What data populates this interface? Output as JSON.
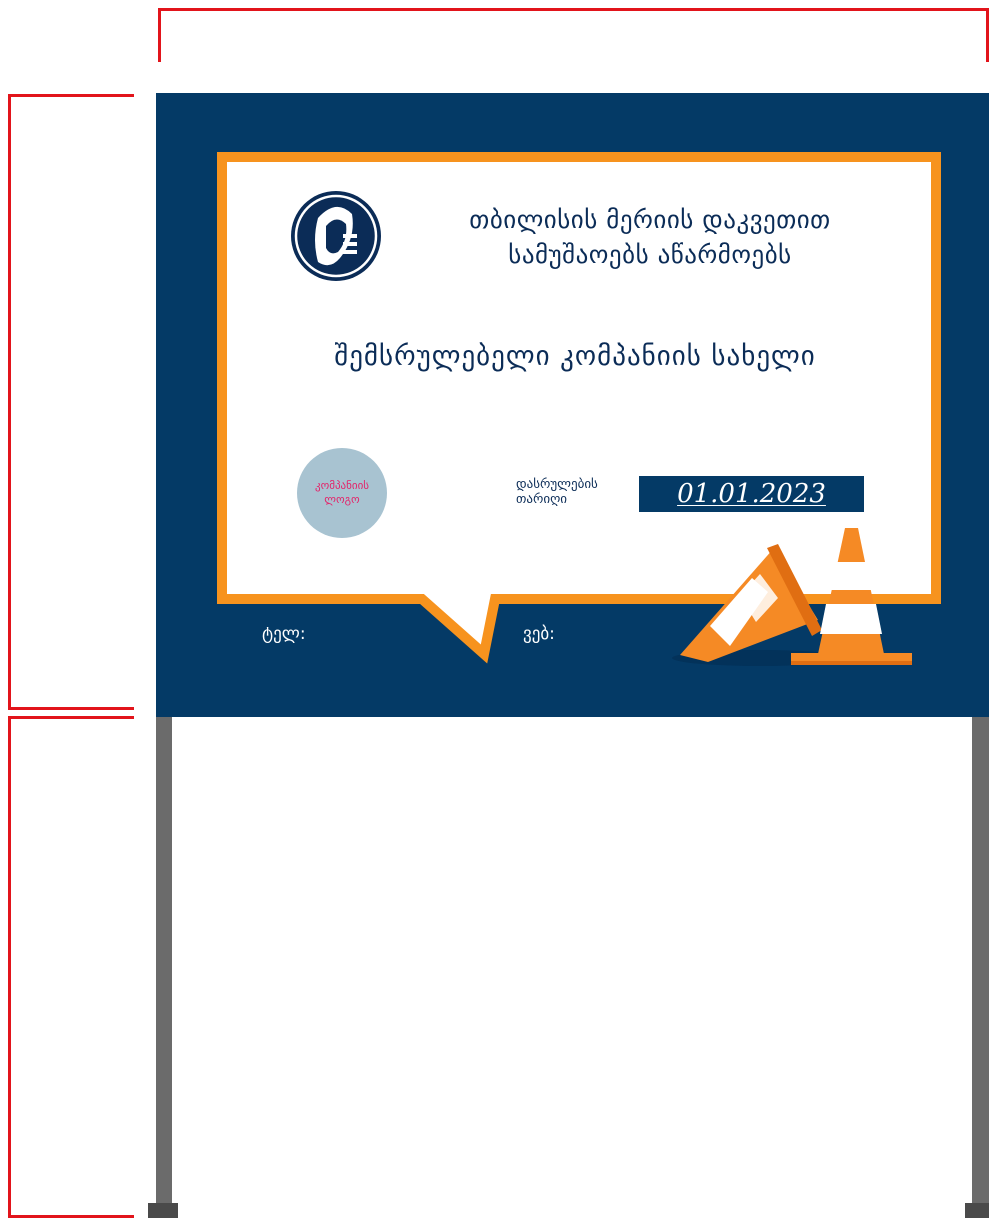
{
  "sign": {
    "title_line1": "თბილისის მერიის დაკვეთით",
    "title_line2": "სამუშაოებს აწარმოებს",
    "company_name": "შემსრულებელი კომპანიის სახელი",
    "company_logo_line1": "კომპანიის",
    "company_logo_line2": "ლოგო",
    "completion_label_line1": "დასრულების",
    "completion_label_line2": "თარიღი",
    "completion_date": "01.01.2023",
    "phone_label": "ტელ:",
    "web_label": "ვებ:"
  },
  "icons": {
    "emblem": "tbilisi-city-emblem",
    "cones": "traffic-cones-icon"
  },
  "colors": {
    "board": "#043a66",
    "frame": "#f7931e",
    "text": "#0b2c57",
    "logo_circle": "#a8c3d1",
    "logo_text": "#e3246a",
    "dimension_lines": "#e2141b",
    "posts": "#6b6b6b"
  }
}
